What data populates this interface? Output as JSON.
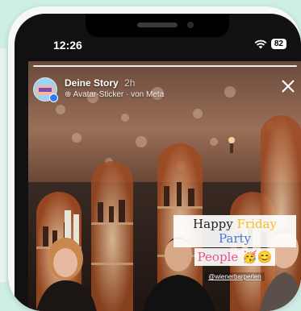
{
  "status_bar": {
    "time": "12:26",
    "battery": "82"
  },
  "story": {
    "title": "Deine Story",
    "time_ago": "2h",
    "subtitle": "Avatar-Sticker · von Meta",
    "sticker": {
      "line1_w1": "Happy",
      "line1_w2": "Friday",
      "line1_w3": "Party",
      "line2_w1": "People",
      "line2_emoji": "🥳😊",
      "handle": "@wienerbarperlen"
    }
  },
  "colors": {
    "friday": "#f2c12e",
    "party": "#4a78d6",
    "people": "#e5548f"
  },
  "icons": [
    "close-icon",
    "wifi-icon",
    "sticker-icon",
    "verified-badge-icon"
  ]
}
